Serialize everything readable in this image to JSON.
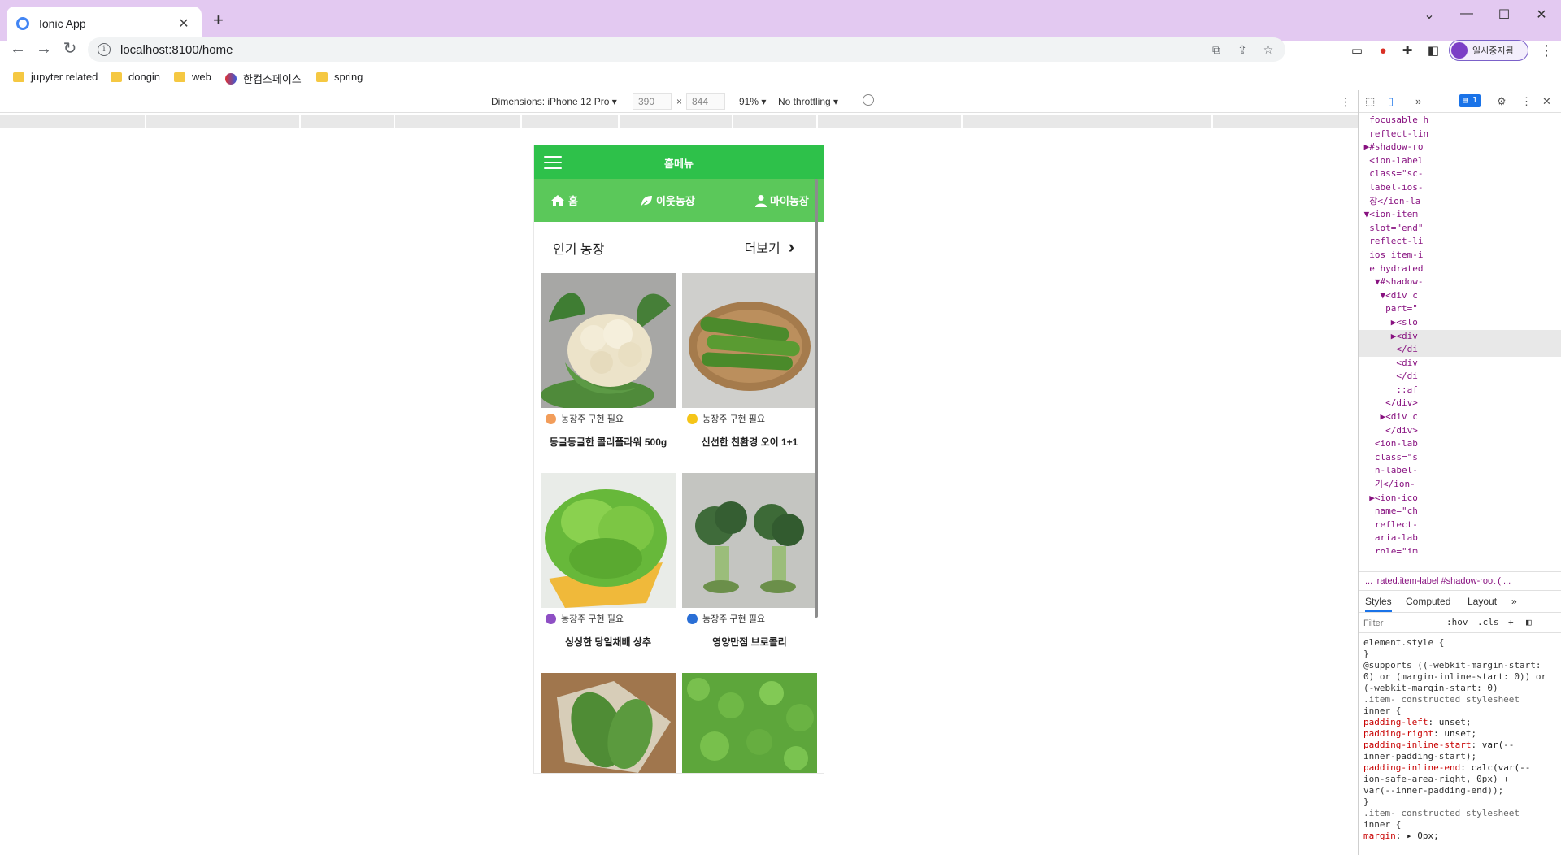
{
  "browser": {
    "tab_title": "Ionic App",
    "url": "localhost:8100/home",
    "profile_label": "일시중지됨",
    "bookmarks": [
      "jupyter related",
      "dongin",
      "web",
      "한컴스페이스",
      "spring"
    ]
  },
  "device_toolbar": {
    "dimensions_label": "Dimensions: iPhone 12 Pro",
    "width": "390",
    "height": "844",
    "zoom": "91%",
    "throttling": "No throttling"
  },
  "app": {
    "title": "홈메뉴",
    "tabs": [
      {
        "label": "홈",
        "icon": "home-icon"
      },
      {
        "label": "이웃농장",
        "icon": "leaf-icon"
      },
      {
        "label": "마이농장",
        "icon": "person-icon"
      }
    ],
    "section_title": "인기 농장",
    "more_label": "더보기",
    "products": [
      {
        "badge": "농장주 구현 필요",
        "name": "동글동글한 콜리플라워 500g",
        "image": "cauliflower-image",
        "badge_color": "#f29d5a"
      },
      {
        "badge": "농장주 구현 필요",
        "name": "신선한 친환경 오이 1+1",
        "image": "cucumber-image",
        "badge_color": "#f5c518"
      },
      {
        "badge": "농장주 구현 필요",
        "name": "싱싱한 당일채배 상추",
        "image": "lettuce-image",
        "badge_color": "#8e4fc4"
      },
      {
        "badge": "농장주 구현 필요",
        "name": "영양만점 브로콜리",
        "image": "broccoli-image",
        "badge_color": "#2a6fd6"
      },
      {
        "badge": "",
        "name": "",
        "image": "romaine-image",
        "badge_color": ""
      },
      {
        "badge": "",
        "name": "",
        "image": "greens-field-image",
        "badge_color": ""
      }
    ]
  },
  "devtools": {
    "dom_lines": [
      "  focusable h",
      "  reflect-lin",
      " ▶#shadow-ro",
      "  <ion-label",
      "  class=\"sc-",
      "  label-ios-",
      "  장</ion-la",
      " ▼<ion-item",
      "  slot=\"end\"",
      "  reflect-li",
      "  ios item-i",
      "  e hydrated",
      "   ▼#shadow-",
      "    ▼<div c",
      "     part=\"",
      "      ▶<slo",
      "      ▶<div",
      "       </di",
      "       <div",
      "       </di",
      "       ::af",
      "     </div>",
      "    ▶<div c",
      "     </div>",
      "   <ion-lab",
      "   class=\"s",
      "   n-label-",
      "   기</ion-",
      "  ▶<ion-ico",
      "   name=\"ch",
      "   reflect-",
      "   aria-lab",
      "   role=\"im"
    ],
    "breadcrumbs": "... lrated.item-label  #shadow-root  ( ...",
    "tabs": [
      "Styles",
      "Computed",
      "Layout"
    ],
    "filter_placeholder": "Filter",
    "filter_hov": ":hov",
    "filter_cls": ".cls",
    "styles": [
      "element.style {",
      "}",
      "@supports ((-webkit-margin-start:",
      "0) or (margin-inline-start: 0)) or",
      "(-webkit-margin-start: 0)",
      ".item-      constructed stylesheet",
      "inner {",
      "  padding-left: unset;",
      "  padding-right: unset;",
      "  padding-inline-start: var(--",
      "     inner-padding-start);",
      "  padding-inline-end: calc(var(--",
      "     ion-safe-area-right, 0px) +",
      "     var(--inner-padding-end));",
      "}",
      ".item-      constructed stylesheet",
      "inner {",
      "  margin: ▸ 0px;"
    ]
  }
}
